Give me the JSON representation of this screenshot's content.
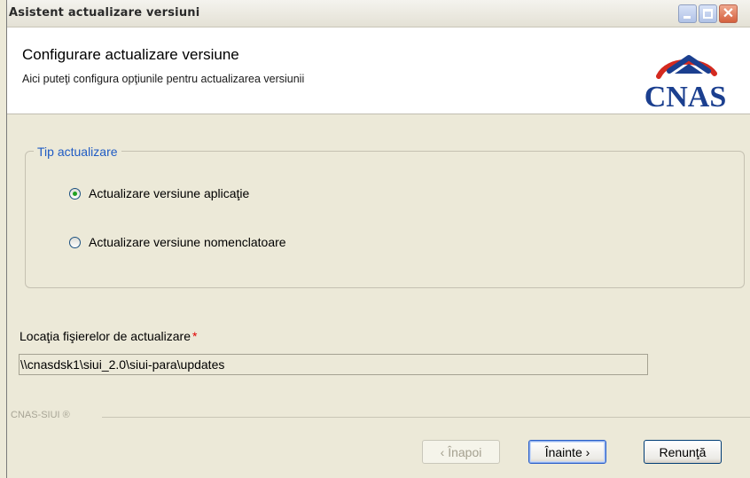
{
  "window": {
    "title": "Asistent actualizare versiuni",
    "controls": {
      "minimize_icon": "minimize-icon",
      "maximize_icon": "maximize-icon",
      "close_icon": "close-icon",
      "close_glyph": "✕"
    }
  },
  "header": {
    "title": "Configurare actualizare versiune",
    "subtitle": "Aici puteţi configura opţiunile pentru actualizarea versiunii",
    "logo_text": "CNAS",
    "logo_icon": "cnas-logo"
  },
  "update_type": {
    "legend": "Tip actualizare",
    "options": [
      {
        "label": "Actualizare versiune aplicaţie",
        "selected": true
      },
      {
        "label": "Actualizare versiune nomenclatoare",
        "selected": false
      }
    ]
  },
  "location": {
    "label": "Locaţia fişierelor de actualizare",
    "required_mark": "*",
    "value": "\\\\cnasdsk1\\siui_2.0\\siui-para\\updates"
  },
  "footer": {
    "brand": "CNAS-SIUI ®",
    "buttons": {
      "back": "‹ Înapoi",
      "next": "Înainte ›",
      "cancel": "Renunţă"
    }
  },
  "colors": {
    "background": "#ece9d8",
    "accent_legend": "#1f5bc4",
    "logo_blue": "#1b3f8f",
    "logo_red": "#d42a1f",
    "required_red": "#e00000"
  }
}
